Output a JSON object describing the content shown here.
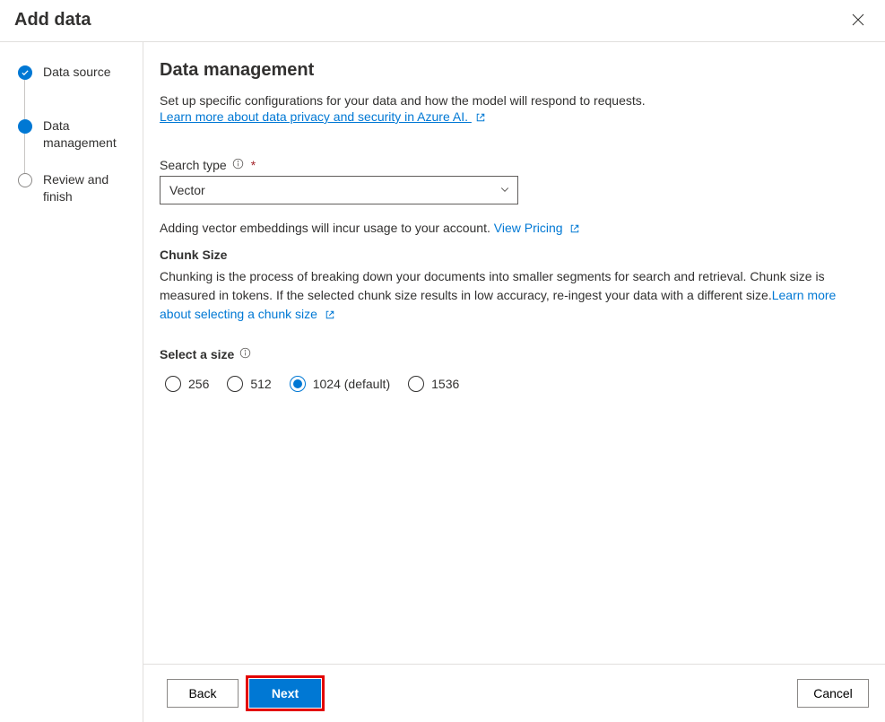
{
  "dialog": {
    "title": "Add data"
  },
  "stepper": {
    "steps": [
      {
        "label": "Data source",
        "state": "done"
      },
      {
        "label": "Data management",
        "state": "current"
      },
      {
        "label": "Review and finish",
        "state": "upcoming"
      }
    ]
  },
  "page": {
    "heading": "Data management",
    "intro": "Set up specific configurations for your data and how the model will respond to requests.",
    "learn_link": "Learn more about data privacy and security in Azure AI."
  },
  "search_type": {
    "label": "Search type",
    "required": "*",
    "selected": "Vector",
    "hint_prefix": "Adding vector embeddings will incur usage to your account. ",
    "pricing_link": "View Pricing"
  },
  "chunk": {
    "title": "Chunk Size",
    "desc_before": "Chunking is the process of breaking down your documents into smaller segments for search and retrieval. Chunk size is measured in tokens. If the selected chunk size results in low accuracy, re-ingest your data with a different size.",
    "learn_link": "Learn more about selecting a chunk size",
    "select_label": "Select a size",
    "options": [
      {
        "label": "256",
        "selected": false
      },
      {
        "label": "512",
        "selected": false
      },
      {
        "label": "1024 (default)",
        "selected": true
      },
      {
        "label": "1536",
        "selected": false
      }
    ]
  },
  "footer": {
    "back": "Back",
    "next": "Next",
    "cancel": "Cancel"
  }
}
